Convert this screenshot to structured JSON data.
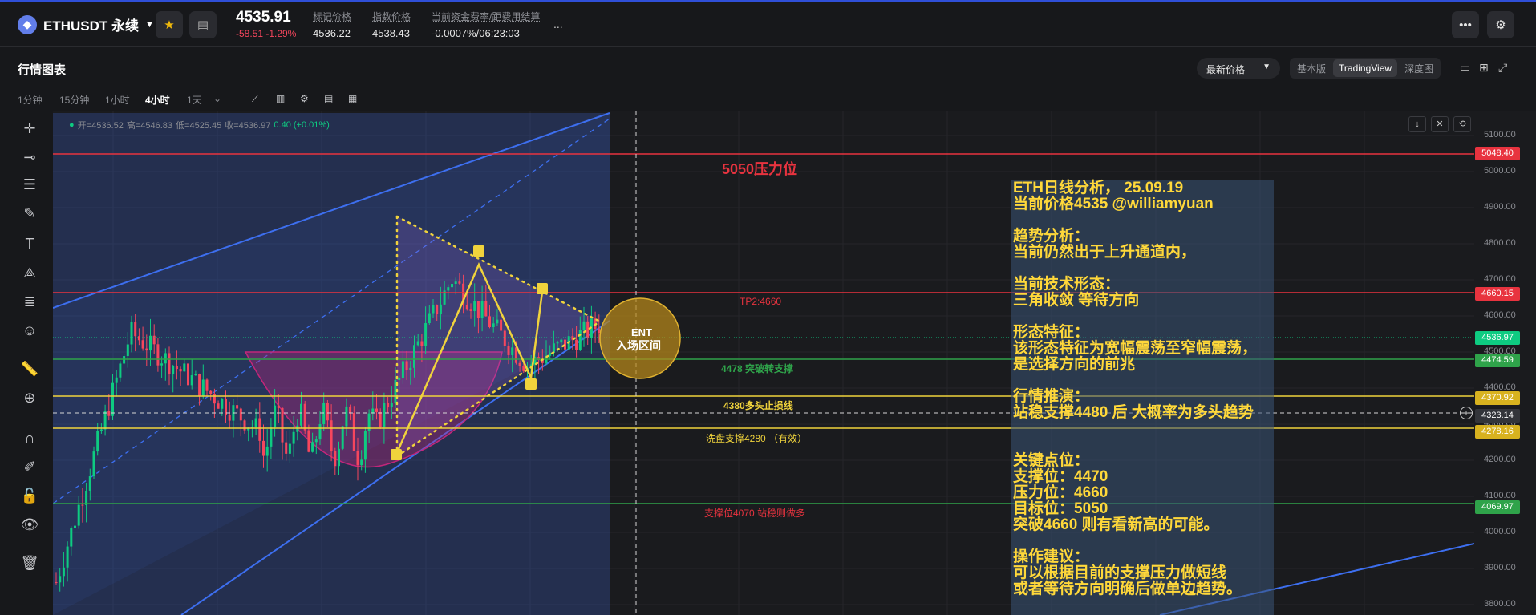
{
  "header": {
    "symbol": "ETHUSDT 永续",
    "last_price": "4535.91",
    "change": "-58.51 -1.29%",
    "stats": [
      {
        "label": "标记价格",
        "value": "4536.22"
      },
      {
        "label": "指数价格",
        "value": "4538.43"
      },
      {
        "label": "当前资金费率/距费用结算",
        "value": "-0.0007%/06:23:03"
      }
    ],
    "more": "..."
  },
  "section": {
    "title": "行情图表",
    "price_select": "最新价格",
    "view_tabs": [
      "基本版",
      "TradingView",
      "深度图"
    ],
    "active_view": "TradingView"
  },
  "timeframes": [
    "1分钟",
    "15分钟",
    "1小时",
    "4小时",
    "1天"
  ],
  "active_timeframe": "4小时",
  "ohlc": {
    "open": "开=4536.52",
    "high": "高=4546.83",
    "low": "低=4525.45",
    "close": "收=4536.97",
    "change": "0.40 (+0.01%)"
  },
  "price_axis": {
    "ticks": [
      "5100.00",
      "5000.00",
      "4900.00",
      "4800.00",
      "4700.00",
      "4600.00",
      "4500.00",
      "4400.00",
      "4300.00",
      "4200.00",
      "4100.00",
      "4000.00",
      "3900.00",
      "3800.00"
    ],
    "labels": [
      {
        "text": "5048.40",
        "color": "#e8333f"
      },
      {
        "text": "4660.15",
        "color": "#e8333f"
      },
      {
        "text": "4536.97",
        "color": "#0ecb81"
      },
      {
        "text": "4474.59",
        "color": "#2fa34a"
      },
      {
        "text": "4370.92",
        "color": "#d8b21f"
      },
      {
        "text": "4323.14",
        "color": "#33353a"
      },
      {
        "text": "4278.16",
        "color": "#d8b21f"
      },
      {
        "text": "4069.97",
        "color": "#2fa34a"
      }
    ]
  },
  "annotations": {
    "resistance_5050": "5050压力位",
    "tp2": "TP2:4660",
    "support_4478": "4478 突破转支撑",
    "stop_4380": "4380多头止损线",
    "shakeout_4280": "洗盘支撑4280 （有效）",
    "support_4070": "支撑位4070 站稳则做多",
    "ent_line1": "ENT",
    "ent_line2": "入场区间"
  },
  "analysis_lines": [
    "ETH日线分析， 25.09.19",
    "当前价格4535 @williamyuan",
    "",
    "趋势分析：",
    "当前仍然出于上升通道内，",
    "",
    "当前技术形态：",
    "三角收敛 等待方向",
    "",
    "形态特征：",
    "该形态特征为宽幅震荡至窄幅震荡，",
    "是选择方向的前兆",
    "",
    "行情推演：",
    "站稳支撑4480 后 大概率为多头趋势",
    "",
    "",
    "关键点位：",
    "支撑位：4470",
    "压力位：4660",
    "目标位：5050",
    "突破4660 则有看新高的可能。",
    "",
    "操作建议：",
    "可以根据目前的支撑压力做短线",
    "或者等待方向明确后做单边趋势。"
  ],
  "colors": {
    "up": "#0ecb81",
    "down": "#f6465d",
    "accent_yellow": "#f0d33c",
    "channel_blue": "#3d6ff0",
    "resistance_red": "#e8333f"
  }
}
